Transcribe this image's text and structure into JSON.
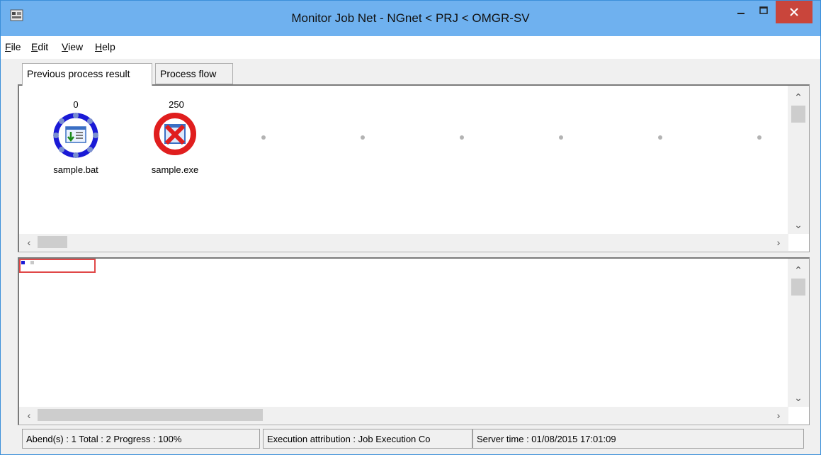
{
  "window": {
    "title": "Monitor Job Net - NGnet < PRJ < OMGR-SV",
    "controls": {
      "minimize": "minimize",
      "maximize": "maximize",
      "close": "close"
    },
    "colors": {
      "titlebar": "#6fb1ef",
      "close": "#c9453b"
    }
  },
  "menu": {
    "items": [
      {
        "label": "File",
        "access": "F",
        "rest": "ile"
      },
      {
        "label": "Edit",
        "access": "E",
        "rest": "dit"
      },
      {
        "label": "View",
        "access": "V",
        "rest": "iew"
      },
      {
        "label": "Help",
        "access": "H",
        "rest": "elp"
      }
    ]
  },
  "tabs": [
    {
      "label": "Previous process result",
      "active": true
    },
    {
      "label": "Process flow",
      "active": false
    }
  ],
  "jobs": [
    {
      "name": "sample.bat",
      "return_code": "0",
      "status": "normal-end",
      "ring_color": "#1a1ad6"
    },
    {
      "name": "sample.exe",
      "return_code": "250",
      "status": "abend",
      "ring_color": "#e01e1e"
    }
  ],
  "status": {
    "summary": "Abend(s) : 1 Total : 2 Progress : 100%",
    "attribution": "Execution attribution : Job Execution Co",
    "server_time": "Server time : 01/08/2015 17:01:09"
  }
}
